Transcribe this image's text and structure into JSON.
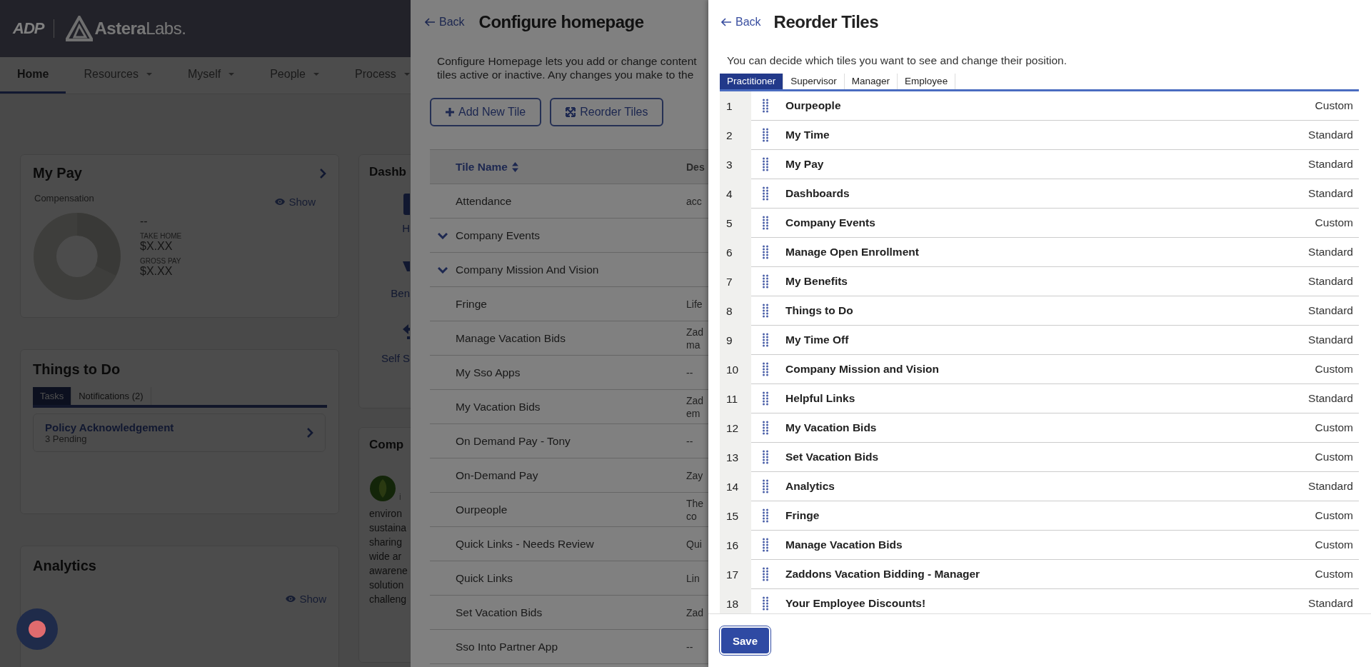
{
  "header": {
    "adp_logo": "ADP",
    "company_logo": "**Astera**Labs."
  },
  "nav": [
    {
      "label": "Home",
      "selected": true,
      "dropdown": false
    },
    {
      "label": "Resources",
      "selected": false,
      "dropdown": true
    },
    {
      "label": "Myself",
      "selected": false,
      "dropdown": true
    },
    {
      "label": "People",
      "selected": false,
      "dropdown": true
    },
    {
      "label": "Process",
      "selected": false,
      "dropdown": true
    }
  ],
  "my_pay": {
    "title": "My Pay",
    "subtitle": "Compensation",
    "show": "Show",
    "amount": "--",
    "take_home_label": "TAKE HOME",
    "take_home": "$X.XX",
    "gross_label": "GROSS PAY",
    "gross": "$X.XX"
  },
  "things_to_do": {
    "title": "Things to Do",
    "tabs": [
      {
        "label": "Tasks",
        "selected": true
      },
      {
        "label": "Notifications (2)",
        "selected": false
      }
    ],
    "tasks": [
      {
        "title": "Policy Acknowledgement",
        "detail": "3 Pending"
      }
    ]
  },
  "analytics": {
    "title": "Analytics",
    "show": "Show"
  },
  "dashboards": {
    "title": "Dashb",
    "links": [
      "H",
      "Ben",
      "Self S"
    ]
  },
  "company": {
    "title": "Comp",
    "logo_caption": "i",
    "lines": [
      "environ",
      "sustaina",
      "sharing",
      "wide ar",
      "awarene",
      "solution",
      "challeng"
    ]
  },
  "configure": {
    "back": "Back",
    "title": "Configure homepage",
    "description_lines": [
      "Configure Homepage lets you add or change content",
      "tiles active or inactive. Any changes you make to the"
    ],
    "buttons": [
      {
        "label": "Add New Tile",
        "kind": "add"
      },
      {
        "label": "Reorder Tiles",
        "kind": "reorder"
      }
    ],
    "columns": [
      "Tile Name",
      "Des"
    ],
    "rows": [
      {
        "name": "Attendance",
        "kind": "tile",
        "description": [
          "acc"
        ]
      },
      {
        "name": "Company Events",
        "kind": "group",
        "expanded": false
      },
      {
        "name": "Company Mission And Vision",
        "kind": "group",
        "expanded": false
      },
      {
        "name": "Fringe",
        "kind": "tile",
        "description": [
          "Life"
        ]
      },
      {
        "name": "Manage Vacation Bids",
        "kind": "tile",
        "description": [
          "Zad",
          "ma"
        ]
      },
      {
        "name": "My Sso Apps",
        "kind": "tile",
        "description": [
          "--"
        ]
      },
      {
        "name": "My Vacation Bids",
        "kind": "tile",
        "description": [
          "Zad",
          "em"
        ]
      },
      {
        "name": "On Demand Pay - Tony",
        "kind": "tile",
        "description": [
          "--"
        ]
      },
      {
        "name": "On-Demand Pay",
        "kind": "tile",
        "description": [
          "Zay"
        ]
      },
      {
        "name": "Ourpeople",
        "kind": "tile",
        "description": [
          "The",
          "co"
        ]
      },
      {
        "name": "Quick Links - Needs Review",
        "kind": "tile",
        "description": [
          "Qui"
        ]
      },
      {
        "name": "Quick Links",
        "kind": "tile",
        "description": [
          "Lin"
        ]
      },
      {
        "name": "Set Vacation Bids",
        "kind": "tile",
        "description": [
          "Zad"
        ]
      },
      {
        "name": "Sso Into Partner App",
        "kind": "tile",
        "description": [
          "--"
        ]
      }
    ]
  },
  "reorder": {
    "back": "Back",
    "title": "Reorder Tiles",
    "description": "You can decide which tiles you want to see and change their position.",
    "tabs": [
      {
        "label": "Practitioner",
        "selected": true
      },
      {
        "label": "Supervisor",
        "selected": false
      },
      {
        "label": "Manager",
        "selected": false
      },
      {
        "label": "Employee",
        "selected": false
      }
    ],
    "rows": [
      {
        "number": "1",
        "name": "Ourpeople",
        "type": "Custom"
      },
      {
        "number": "2",
        "name": "My Time",
        "type": "Standard"
      },
      {
        "number": "3",
        "name": "My Pay",
        "type": "Standard"
      },
      {
        "number": "4",
        "name": "Dashboards",
        "type": "Standard"
      },
      {
        "number": "5",
        "name": "Company Events",
        "type": "Custom"
      },
      {
        "number": "6",
        "name": "Manage Open Enrollment",
        "type": "Standard"
      },
      {
        "number": "7",
        "name": "My Benefits",
        "type": "Standard"
      },
      {
        "number": "8",
        "name": "Things to Do",
        "type": "Standard"
      },
      {
        "number": "9",
        "name": "My Time Off",
        "type": "Standard"
      },
      {
        "number": "10",
        "name": "Company Mission and Vision",
        "type": "Custom"
      },
      {
        "number": "11",
        "name": "Helpful Links",
        "type": "Standard"
      },
      {
        "number": "12",
        "name": "My Vacation Bids",
        "type": "Custom"
      },
      {
        "number": "13",
        "name": "Set Vacation Bids",
        "type": "Custom"
      },
      {
        "number": "14",
        "name": "Analytics",
        "type": "Standard"
      },
      {
        "number": "15",
        "name": "Fringe",
        "type": "Custom"
      },
      {
        "number": "16",
        "name": "Manage Vacation Bids",
        "type": "Custom"
      },
      {
        "number": "17",
        "name": "Zaddons Vacation Bidding - Manager",
        "type": "Custom"
      },
      {
        "number": "18",
        "name": "Your Employee Discounts!",
        "type": "Standard"
      }
    ],
    "save": "Save"
  }
}
